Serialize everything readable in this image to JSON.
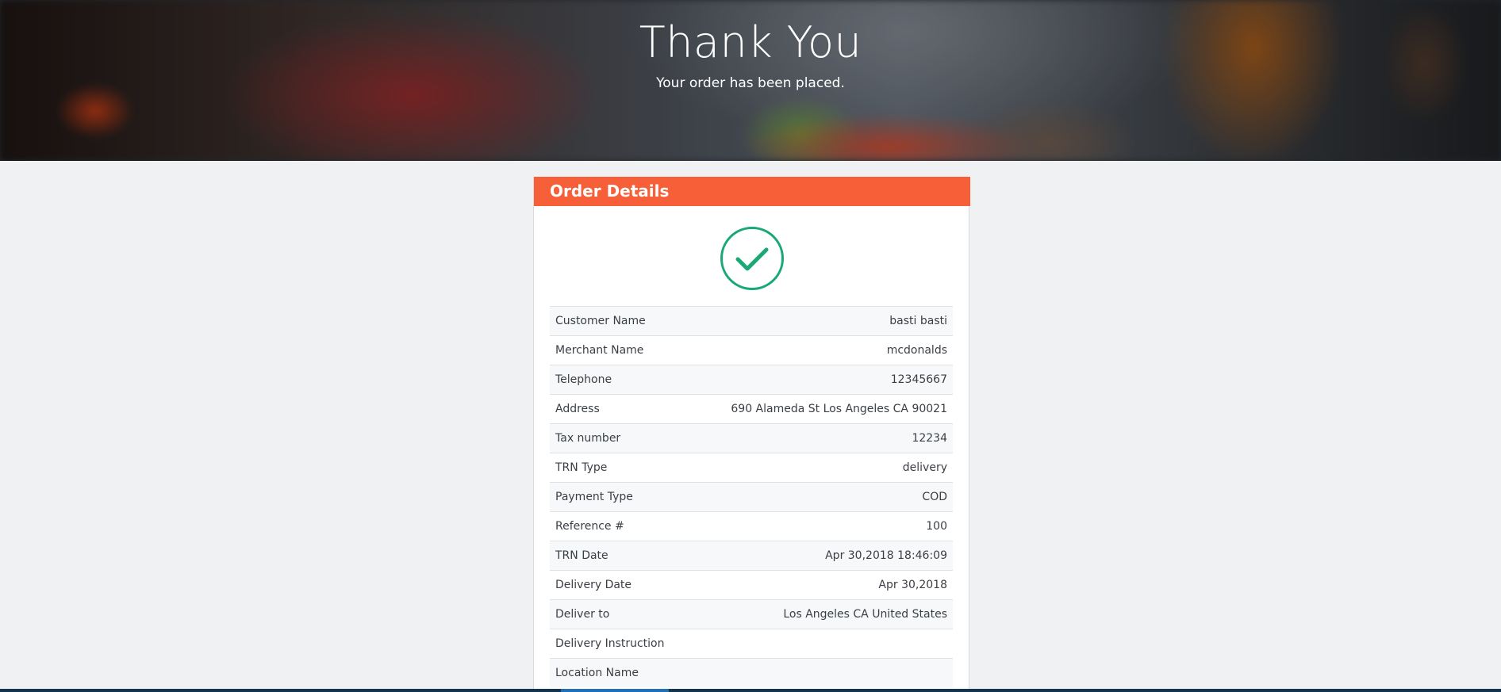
{
  "hero": {
    "title": "Thank You",
    "subtitle": "Your order has been placed."
  },
  "order": {
    "header": "Order Details",
    "status_icon": "check-circle-icon",
    "rows": [
      {
        "label": "Customer Name",
        "value": "basti basti"
      },
      {
        "label": "Merchant Name",
        "value": "mcdonalds"
      },
      {
        "label": "Telephone",
        "value": "12345667"
      },
      {
        "label": "Address",
        "value": "690 Alameda St Los Angeles CA 90021"
      },
      {
        "label": "Tax number",
        "value": "12234"
      },
      {
        "label": "TRN Type",
        "value": "delivery"
      },
      {
        "label": "Payment Type",
        "value": "COD"
      },
      {
        "label": "Reference #",
        "value": "100"
      },
      {
        "label": "TRN Date",
        "value": "Apr 30,2018 18:46:09"
      },
      {
        "label": "Delivery Date",
        "value": "Apr 30,2018"
      },
      {
        "label": "Deliver to",
        "value": "Los Angeles CA United States"
      },
      {
        "label": "Delivery Instruction",
        "value": ""
      },
      {
        "label": "Location Name",
        "value": ""
      }
    ]
  },
  "colors": {
    "header_accent": "#f65f38",
    "success": "#19a974",
    "page_background": "#eff1f3"
  }
}
